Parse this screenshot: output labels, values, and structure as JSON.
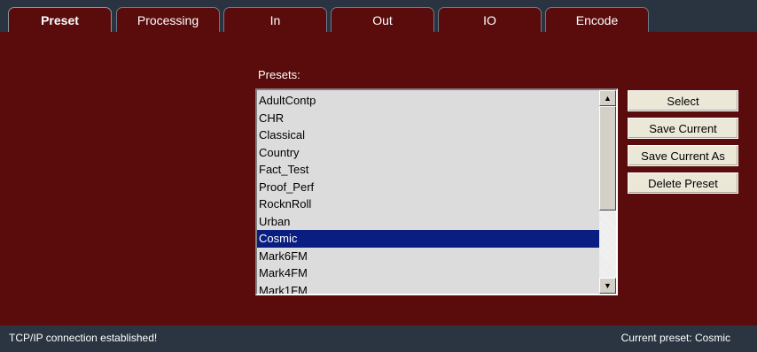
{
  "tabs": [
    {
      "label": "Preset",
      "active": true
    },
    {
      "label": "Processing",
      "active": false
    },
    {
      "label": "In",
      "active": false
    },
    {
      "label": "Out",
      "active": false
    },
    {
      "label": "IO",
      "active": false
    },
    {
      "label": "Encode",
      "active": false
    }
  ],
  "presets_label": "Presets:",
  "presets": [
    "AdultContp",
    "CHR",
    "Classical",
    "Country",
    "Fact_Test",
    "Proof_Perf",
    "RocknRoll",
    "Urban",
    "Cosmic",
    "Mark6FM",
    "Mark4FM",
    "Mark1FM"
  ],
  "selected_preset": "Cosmic",
  "buttons": {
    "select": "Select",
    "save_current": "Save Current",
    "save_current_as": "Save Current As",
    "delete_preset": "Delete Preset"
  },
  "scroll_icons": {
    "up": "up-arrow-icon",
    "down": "down-arrow-icon"
  },
  "status": {
    "left": "TCP/IP connection established!",
    "right": "Current preset: Cosmic"
  },
  "colors": {
    "background": "#5a0c0c",
    "tabbar": "#2a3340",
    "selection": "#0a1e82",
    "list_background": "#dcdcdc",
    "button": "#ebe8d8"
  }
}
